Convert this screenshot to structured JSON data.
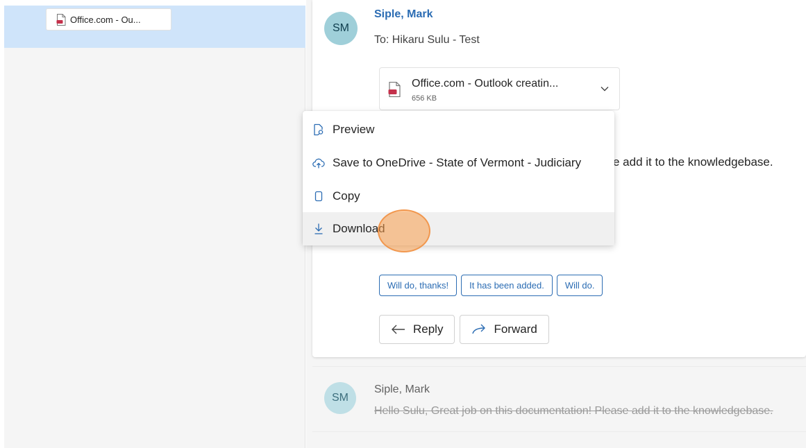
{
  "left_pane": {
    "selected_attachment_label": "Office.com - Ou..."
  },
  "message": {
    "avatar_initials": "SM",
    "sender": "Siple, Mark",
    "to_line": "To:  Hikaru Sulu - Test",
    "attachment": {
      "name": "Office.com - Outlook creatin...",
      "size": "656 KB"
    },
    "body_visible": "e add it to the knowledgebase.",
    "quick_replies": [
      "Will do, thanks!",
      "It has been added.",
      "Will do."
    ],
    "reply_label": "Reply",
    "forward_label": "Forward"
  },
  "context_menu": {
    "items": [
      {
        "label": "Preview",
        "icon": "preview-icon"
      },
      {
        "label": "Save to OneDrive - State of Vermont - Judiciary",
        "icon": "cloud-upload-icon"
      },
      {
        "label": "Copy",
        "icon": "copy-icon"
      },
      {
        "label": "Download",
        "icon": "download-icon"
      }
    ],
    "hovered_item": "Download"
  },
  "collapsed_message": {
    "avatar_initials": "SM",
    "sender": "Siple, Mark",
    "preview": "Hello Sulu, Great job on this documentation! Please add it to the knowledgebase."
  },
  "colors": {
    "accent": "#2b6cb3",
    "selected_bg": "#cfe4fa",
    "avatar_bg": "#9fcfd9",
    "pdf_red": "#c4314b",
    "click_indicator": "#f79c4a"
  }
}
